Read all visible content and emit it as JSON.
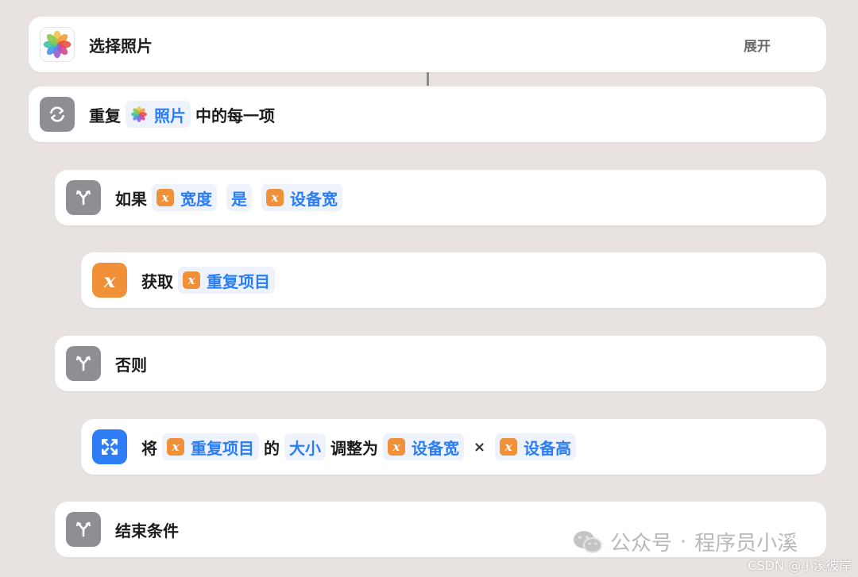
{
  "steps": {
    "select_photos": {
      "title": "选择照片",
      "expand": "展开"
    },
    "repeat": {
      "prefix": "重复",
      "token": "照片",
      "suffix": "中的每一项"
    },
    "if": {
      "label": "如果",
      "var1": "宽度",
      "op": "是",
      "var2": "设备宽"
    },
    "get": {
      "label": "获取",
      "var": "重复项目"
    },
    "otherwise": {
      "label": "否则"
    },
    "resize": {
      "label": "将",
      "var_item": "重复项目",
      "de": "的",
      "size": "大小",
      "adjust": "调整为",
      "var_w": "设备宽",
      "times": "×",
      "var_h": "设备高"
    },
    "end_if": {
      "label": "结束条件"
    }
  },
  "var_glyph": "x",
  "icons": {
    "select_photos": "photos-app-icon",
    "repeat": "repeat-arrows-icon",
    "if": "branch-icon",
    "get": "variable-icon",
    "resize": "resize-arrows-icon"
  },
  "colors": {
    "background": "#e8e3e1",
    "card": "#ffffff",
    "token_text": "#2b7df7",
    "variable_orange": "#f0913a",
    "resize_blue": "#2e7cf6",
    "control_gray": "#8e8e93"
  },
  "watermark": {
    "wechat": "公众号",
    "dot": "·",
    "author": "程序员小溪",
    "csdn": "CSDN @小溪彼岸"
  }
}
